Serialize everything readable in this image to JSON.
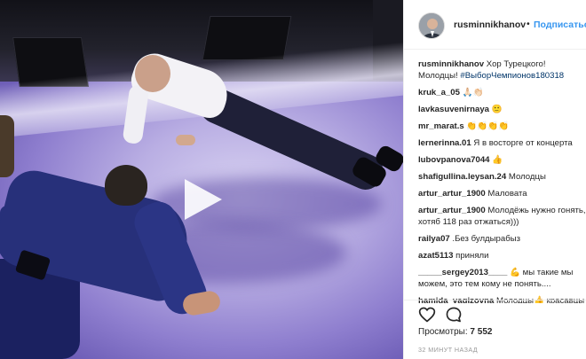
{
  "post": {
    "username": "rusminnikhanov",
    "separator": "•",
    "follow_label": "Подписаться"
  },
  "icons": {
    "play": "play-icon",
    "like": "heart-icon",
    "comment": "comment-icon",
    "avatar": "avatar"
  },
  "caption": {
    "user": "rusminnikhanov",
    "text": "Хор Турецкого! Молодцы! ",
    "hashtag": "#ВыборЧемпионов180318"
  },
  "comments": [
    {
      "user": "kruk_a_05",
      "text": "🙏🏻👏🏻"
    },
    {
      "user": "lavkasuvenirnaya",
      "text": "🙂"
    },
    {
      "user": "mr_marat.s",
      "text": "👏👏👏👏"
    },
    {
      "user": "lernerinna.01",
      "text": "Я в восторге от концерта"
    },
    {
      "user": "lubovpanova7044",
      "text": "👍"
    },
    {
      "user": "shafigullina.leysan.24",
      "text": "Молодцы"
    },
    {
      "user": "artur_artur_1900",
      "text": "Маловата"
    },
    {
      "user": "artur_artur_1900",
      "text": "Молодёжь нужно гонять, хотяб 118 раз отжаться)))"
    },
    {
      "user": "railya07",
      "text": ".Без булдырабыз"
    },
    {
      "user": "azat5113",
      "text": "приняли"
    },
    {
      "user": "_____sergey2013____",
      "text": "💪 мы такие мы можем, это тем кому не понять...."
    },
    {
      "user": "hamida_vagizovna",
      "text": "Молодцы👍 красавцы"
    }
  ],
  "stats": {
    "views_label": "Просмотры:",
    "views_value": "7 552",
    "timestamp": "32 МИНУТ НАЗАД"
  },
  "colors": {
    "link_blue": "#3897f0",
    "hashtag_blue": "#003569",
    "stage_purple": "#8f7fcf",
    "suit_navy": "#27307a"
  }
}
